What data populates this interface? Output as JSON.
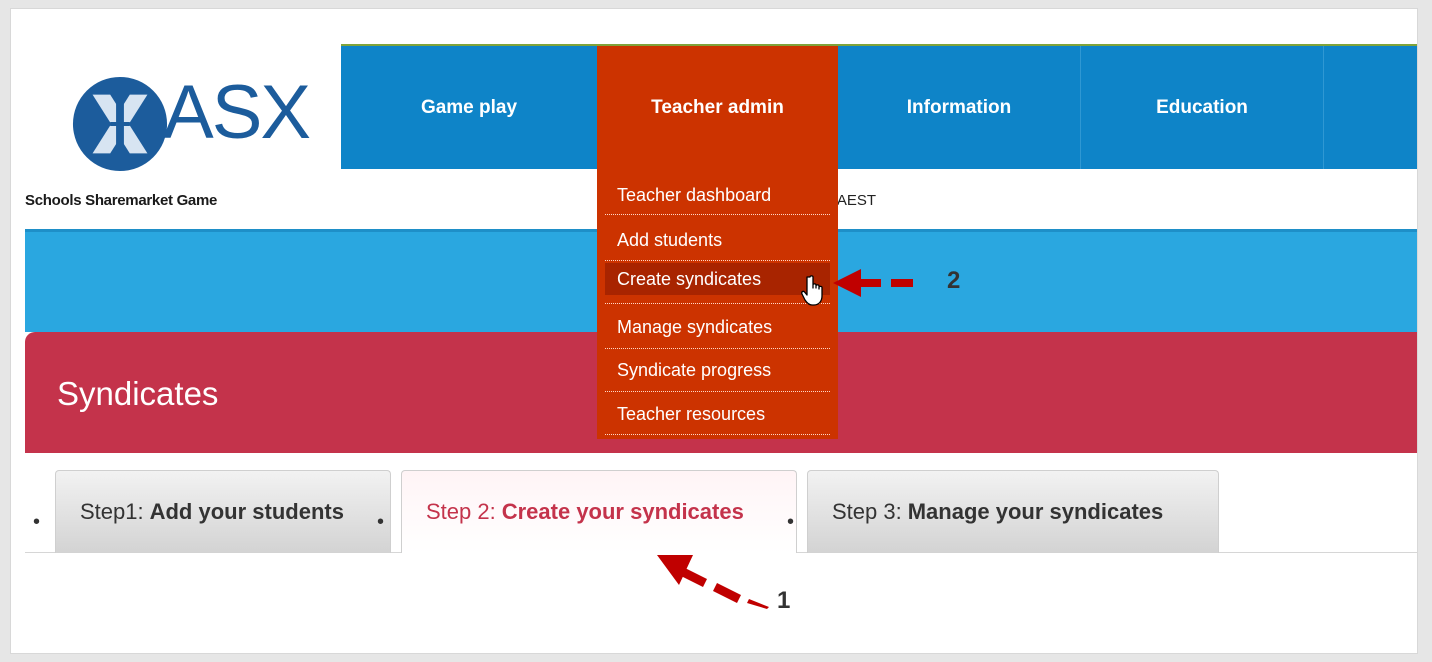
{
  "brand": {
    "logo_text": "ASX",
    "tagline": "Schools Sharemarket Game"
  },
  "header": {
    "time_fragment": "M AEST"
  },
  "nav": {
    "items": [
      {
        "label": "Game play"
      },
      {
        "label": "Teacher admin"
      },
      {
        "label": "Information"
      },
      {
        "label": "Education"
      }
    ],
    "active": "Teacher admin"
  },
  "dropdown": {
    "items": [
      {
        "label": "Teacher dashboard"
      },
      {
        "label": "Add students"
      },
      {
        "label": "Create syndicates"
      },
      {
        "label": "Manage syndicates"
      },
      {
        "label": "Syndicate progress"
      },
      {
        "label": "Teacher resources"
      }
    ],
    "hovered": "Create syndicates"
  },
  "page": {
    "title": "Syndicates"
  },
  "steps": [
    {
      "prefix": "Step1:",
      "label": "Add your students"
    },
    {
      "prefix": "Step 2:",
      "label": "Create your syndicates"
    },
    {
      "prefix": "Step 3:",
      "label": "Manage your syndicates"
    }
  ],
  "bullets": {
    "symbol": "•"
  },
  "annotations": {
    "callout_1": "1",
    "callout_2": "2"
  },
  "colors": {
    "nav_blue": "#0e84c8",
    "active_orange": "#cc3300",
    "band_blue": "#2aa7e0",
    "syndicates_red": "#c4334b",
    "arrow_red": "#c00000"
  }
}
